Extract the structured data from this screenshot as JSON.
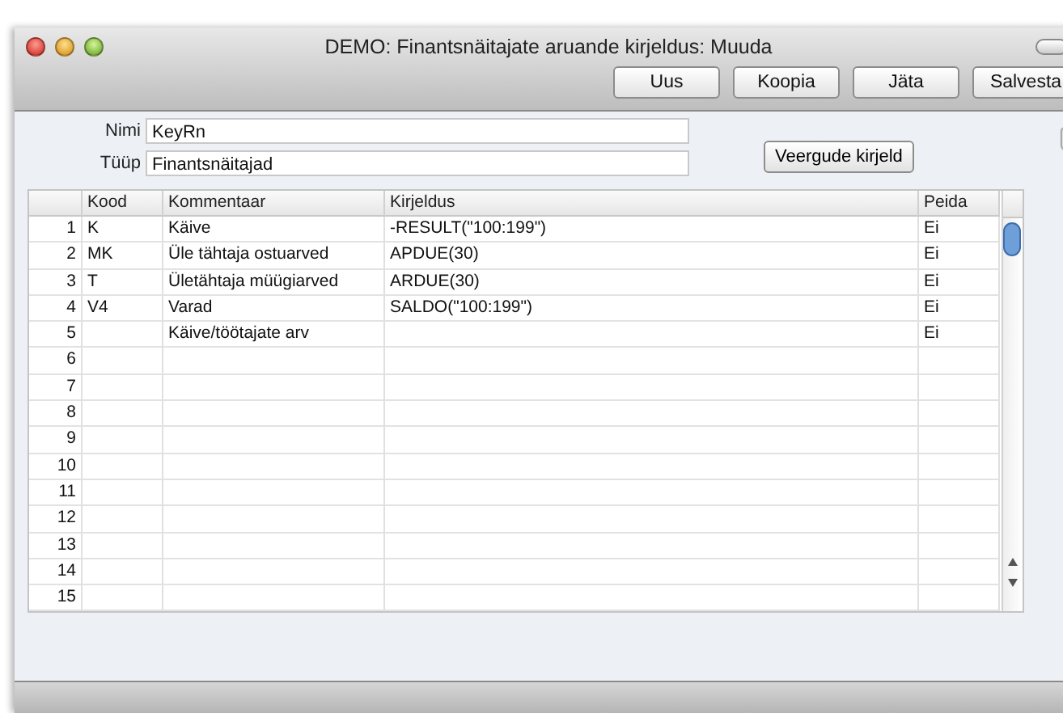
{
  "window": {
    "title": "DEMO: Finantsnäitajate aruande kirjeldus: Muuda"
  },
  "toolbar": {
    "buttons": [
      "Uus",
      "Koopia",
      "Jäta",
      "Salvesta"
    ]
  },
  "form": {
    "fields": [
      {
        "label": "Nimi",
        "value": "KeyRn"
      },
      {
        "label": "Tüüp",
        "value": "Finantsnäitajad"
      }
    ],
    "columns_button": "Veergude kirjeld"
  },
  "table": {
    "columns": [
      "Kood",
      "Kommentaar",
      "Kirjeldus",
      "Peida"
    ],
    "rows": [
      {
        "number": "1",
        "code": "K",
        "comment": "Käive",
        "formula": "-RESULT(\"100:199\")",
        "hide": "Ei"
      },
      {
        "number": "2",
        "code": "MK",
        "comment": "Üle tähtaja ostuarved",
        "formula": "APDUE(30)",
        "hide": "Ei"
      },
      {
        "number": "3",
        "code": "T",
        "comment": "Ületähtaja müügiarved",
        "formula": "ARDUE(30)",
        "hide": "Ei"
      },
      {
        "number": "4",
        "code": "V4",
        "comment": "Varad",
        "formula": "SALDO(\"100:199\")",
        "hide": "Ei"
      },
      {
        "number": "5",
        "comment": "Käive/töötajate arv",
        "hide": "Ei"
      },
      {
        "number": "6"
      },
      {
        "number": "7"
      },
      {
        "number": "8"
      },
      {
        "number": "9"
      },
      {
        "number": "10"
      },
      {
        "number": "11"
      },
      {
        "number": "12"
      },
      {
        "number": "13"
      },
      {
        "number": "14"
      },
      {
        "number": "15"
      }
    ]
  }
}
